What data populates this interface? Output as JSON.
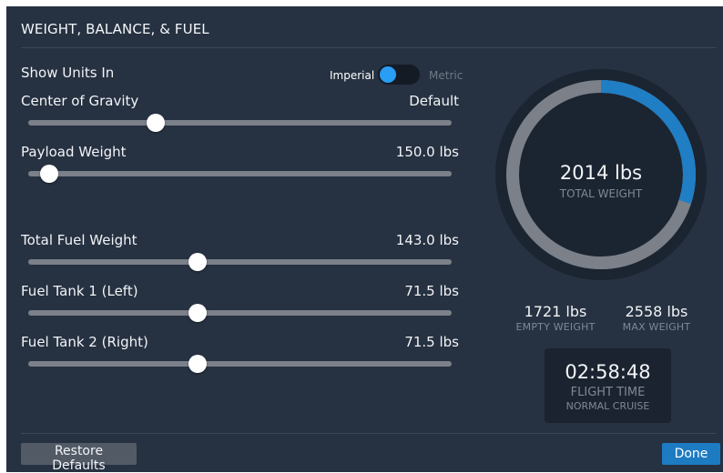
{
  "title": "WEIGHT, BALANCE, & FUEL",
  "units": {
    "label": "Show Units In",
    "option_on": "Imperial",
    "option_off": "Metric",
    "selected": "Imperial"
  },
  "cog": {
    "label": "Center of Gravity",
    "value": "Default",
    "fraction": 0.3
  },
  "payload": {
    "label": "Payload Weight",
    "value": "150.0 lbs",
    "fraction": 0.05
  },
  "total_fuel": {
    "label": "Total Fuel Weight",
    "value": "143.0 lbs",
    "fraction": 0.4
  },
  "tank1": {
    "label": "Fuel Tank 1 (Left)",
    "value": "71.5 lbs",
    "fraction": 0.4
  },
  "tank2": {
    "label": "Fuel Tank 2 (Right)",
    "value": "71.5 lbs",
    "fraction": 0.4
  },
  "gauge": {
    "value": "2014 lbs",
    "caption": "TOTAL WEIGHT",
    "fill_fraction": 0.3,
    "colors": {
      "fill": "#1f7ec4",
      "track": "#7b8089"
    }
  },
  "empty_weight": {
    "value": "1721 lbs",
    "caption": "EMPTY WEIGHT"
  },
  "max_weight": {
    "value": "2558 lbs",
    "caption": "MAX WEIGHT"
  },
  "flight": {
    "time": "02:58:48",
    "caption": "FLIGHT TIME",
    "mode": "NORMAL CRUISE"
  },
  "buttons": {
    "restore": "Restore Defaults",
    "done": "Done"
  },
  "colors": {
    "panel": "#263141",
    "accent": "#1d7bc2",
    "toggle_knob": "#2a9df4"
  }
}
